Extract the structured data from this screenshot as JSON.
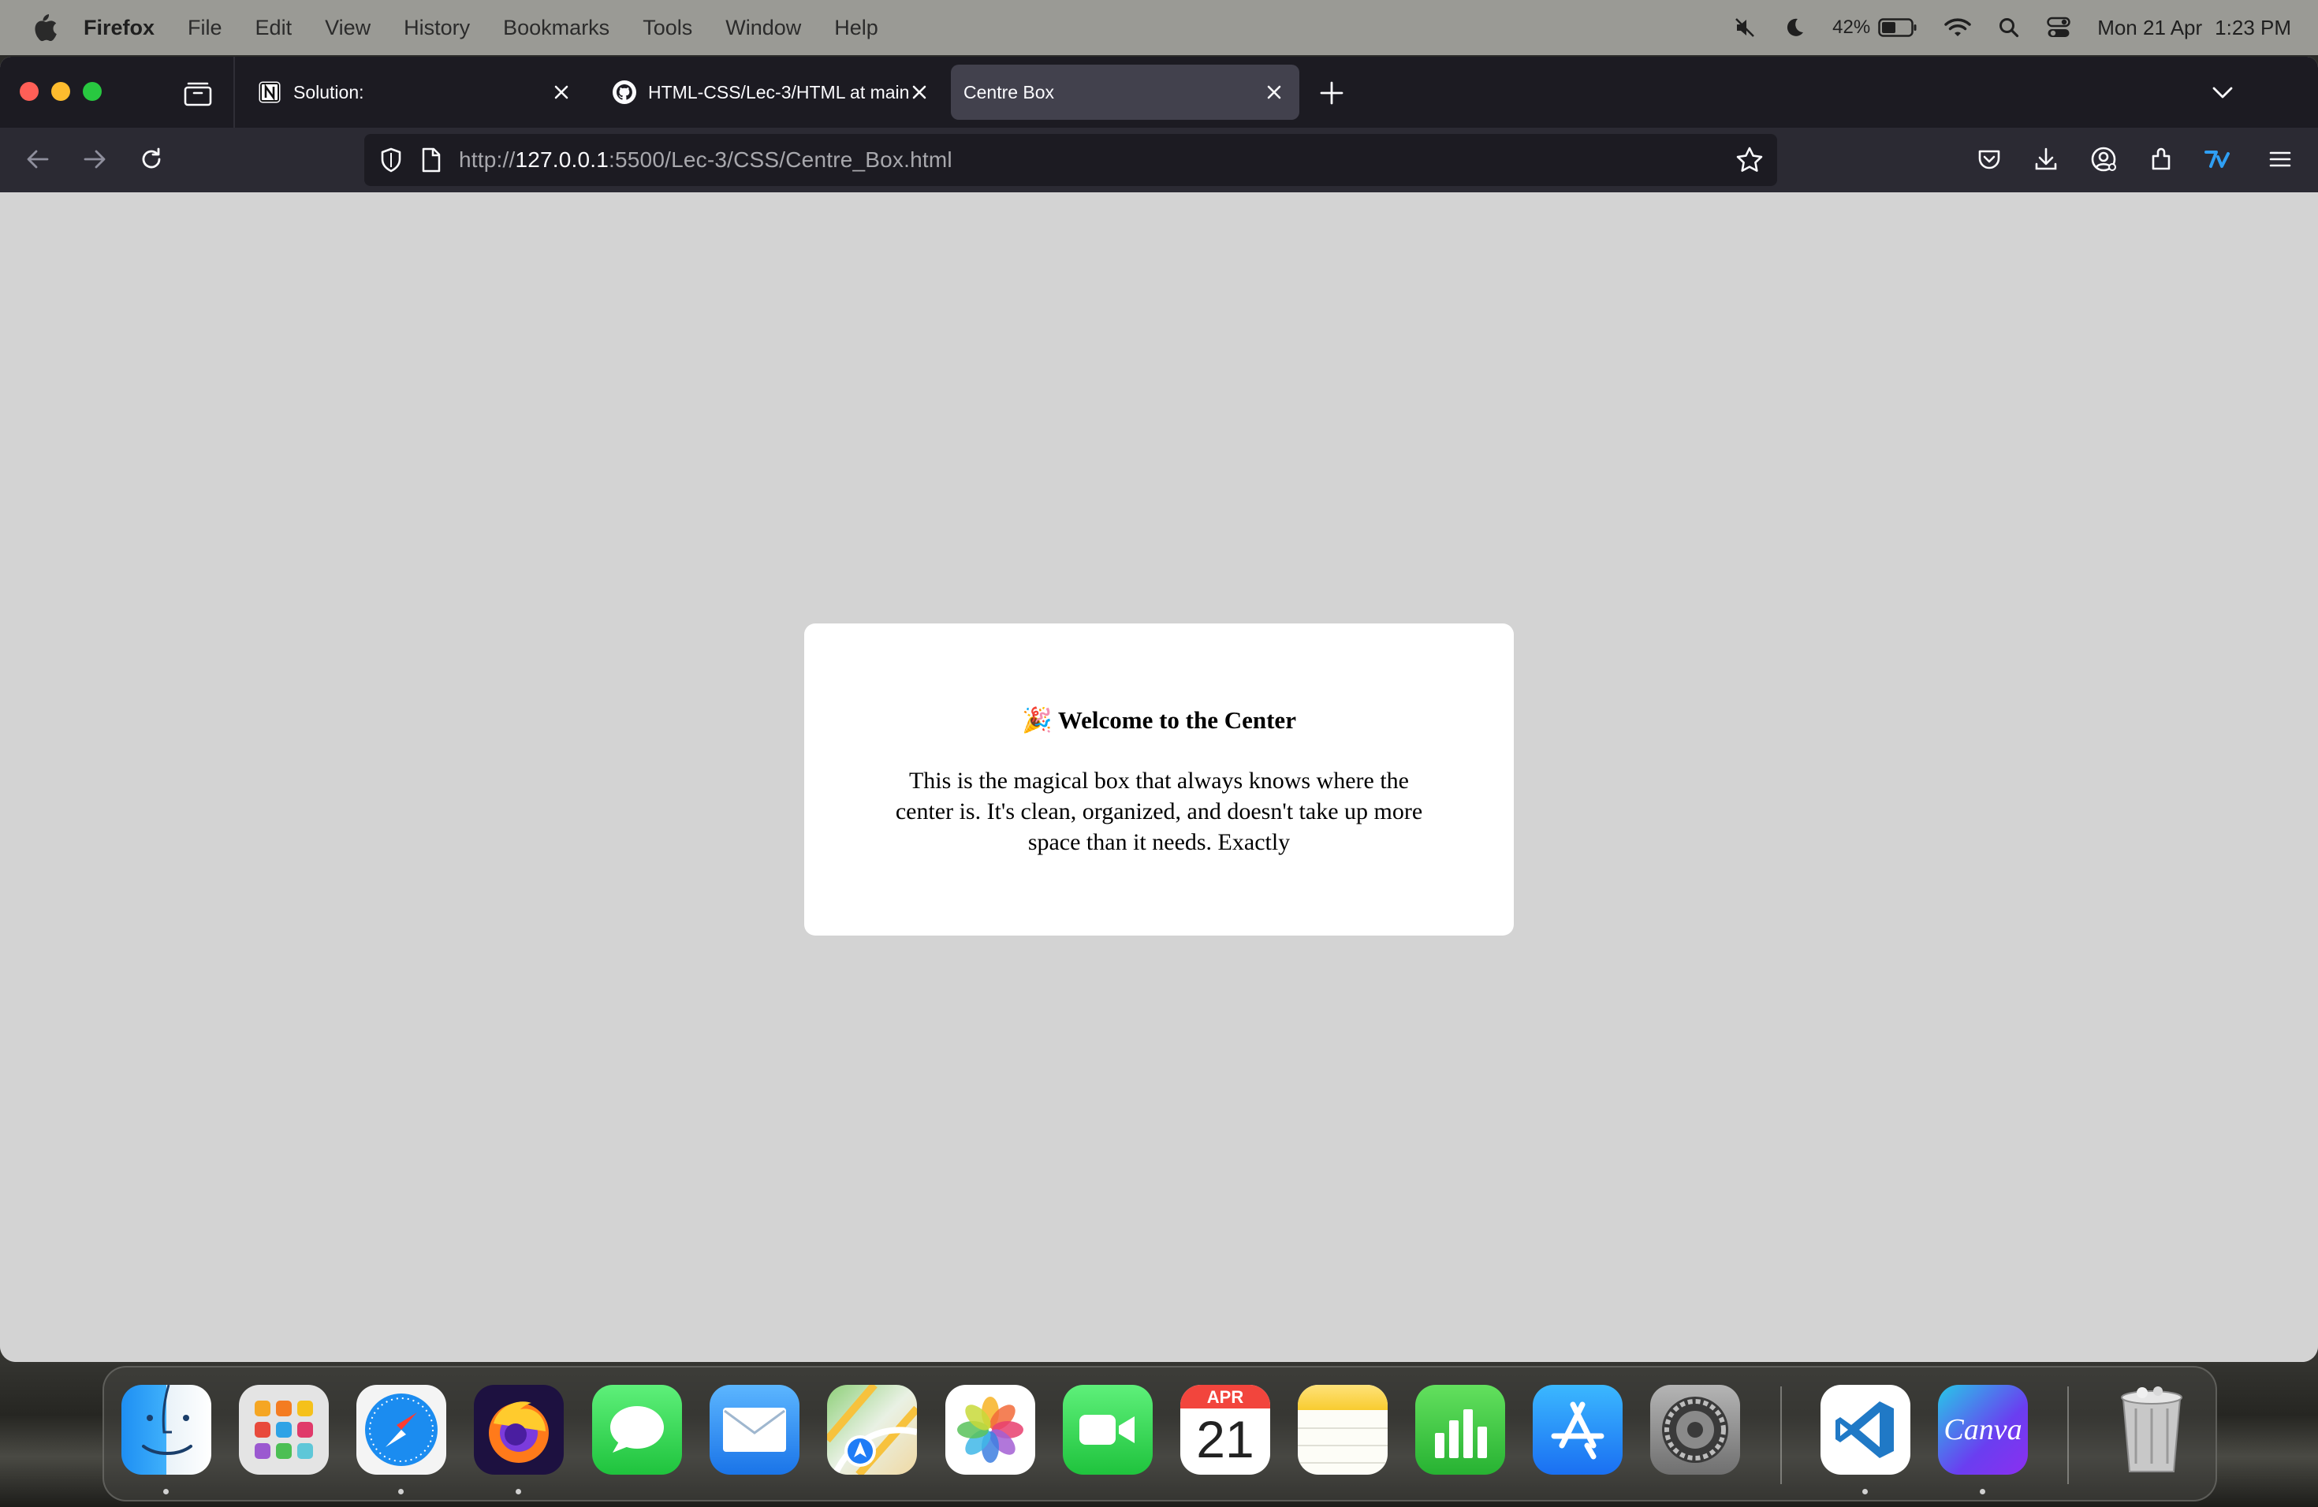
{
  "menubar": {
    "app_name": "Firefox",
    "items": [
      "File",
      "Edit",
      "View",
      "History",
      "Bookmarks",
      "Tools",
      "Window",
      "Help"
    ],
    "battery": "42%",
    "date": "Mon 21 Apr",
    "time": "1:23 PM",
    "status_icons": [
      "mute-icon",
      "moon-icon",
      "battery-icon",
      "wifi-icon",
      "spotlight-icon",
      "control-center-icon"
    ]
  },
  "browser": {
    "tabs": [
      {
        "title": "Solution:",
        "icon": "notion-icon",
        "active": false
      },
      {
        "title": "HTML-CSS/Lec-3/HTML at main",
        "icon": "github-icon",
        "active": false
      },
      {
        "title": "Centre Box",
        "icon": "",
        "active": true
      }
    ],
    "url": {
      "scheme": "http://",
      "host": "127.0.0.1",
      "rest": ":5500/Lec-3/CSS/Centre_Box.html"
    },
    "colors": {
      "tabbar": "#1c1b22",
      "navbar": "#2b2a33",
      "active_tab": "#42414d",
      "page_bg": "#d3d3d3"
    }
  },
  "page": {
    "heading": "🎉 Welcome to the Center",
    "paragraph": "This is the magical box that always knows where the center is. It's clean, organized, and doesn't take up more space than it needs. Exactly"
  },
  "dock": {
    "calendar_month": "APR",
    "calendar_day": "21",
    "canva_label": "Canva",
    "apps": [
      "Finder",
      "Launchpad",
      "Safari",
      "Firefox",
      "Messages",
      "Mail",
      "Maps",
      "Photos",
      "FaceTime",
      "Calendar",
      "Notes",
      "Numbers",
      "App Store",
      "System Settings",
      "Visual Studio Code",
      "Canva",
      "Trash"
    ]
  }
}
